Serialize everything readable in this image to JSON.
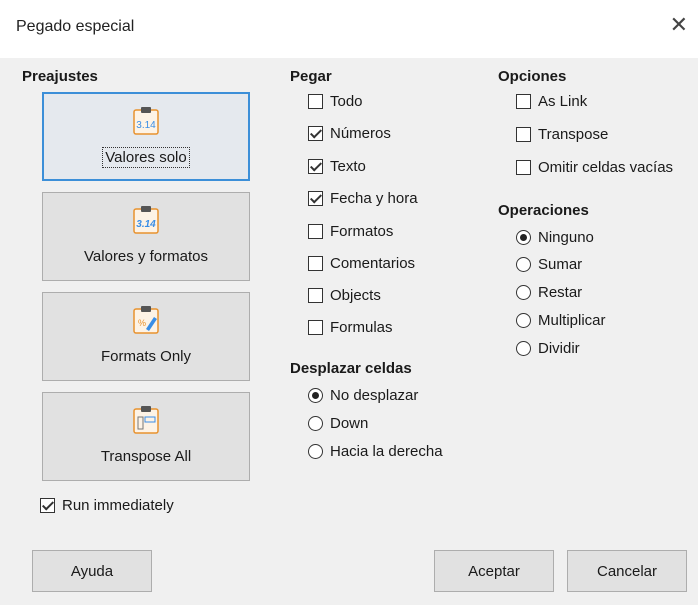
{
  "window": {
    "title": "Pegado especial"
  },
  "presets": {
    "heading": "Preajustes",
    "items": [
      {
        "label": "Valores solo",
        "icon": "clipboard-values-icon",
        "selected": true
      },
      {
        "label": "Valores y formatos",
        "icon": "clipboard-values-formats-icon",
        "selected": false
      },
      {
        "label": "Formats Only",
        "icon": "clipboard-formats-icon",
        "selected": false
      },
      {
        "label": "Transpose All",
        "icon": "clipboard-transpose-icon",
        "selected": false
      }
    ],
    "run_immediately": {
      "label": "Run immediately",
      "checked": true
    }
  },
  "paste": {
    "heading": "Pegar",
    "options": [
      {
        "label": "Todo",
        "checked": false
      },
      {
        "label": "Números",
        "checked": true
      },
      {
        "label": "Texto",
        "checked": true
      },
      {
        "label": "Fecha y hora",
        "checked": true
      },
      {
        "label": "Formatos",
        "checked": false
      },
      {
        "label": "Comentarios",
        "checked": false
      },
      {
        "label": "Objects",
        "checked": false
      },
      {
        "label": "Formulas",
        "checked": false
      }
    ]
  },
  "shift": {
    "heading": "Desplazar celdas",
    "options": [
      {
        "label": "No desplazar",
        "selected": true
      },
      {
        "label": "Down",
        "selected": false
      },
      {
        "label": "Hacia la derecha",
        "selected": false
      }
    ]
  },
  "options": {
    "heading": "Opciones",
    "items": [
      {
        "label": "As Link",
        "checked": false
      },
      {
        "label": "Transpose",
        "checked": false
      },
      {
        "label": "Omitir celdas vacías",
        "checked": false
      }
    ]
  },
  "operations": {
    "heading": "Operaciones",
    "items": [
      {
        "label": "Ninguno",
        "selected": true
      },
      {
        "label": "Sumar",
        "selected": false
      },
      {
        "label": "Restar",
        "selected": false
      },
      {
        "label": "Multiplicar",
        "selected": false
      },
      {
        "label": "Dividir",
        "selected": false
      }
    ]
  },
  "buttons": {
    "help": "Ayuda",
    "ok": "Aceptar",
    "cancel": "Cancelar"
  },
  "colors": {
    "accent": "#3c8fd8",
    "icon_orange": "#e8922e",
    "icon_blue": "#3a8ee6"
  }
}
